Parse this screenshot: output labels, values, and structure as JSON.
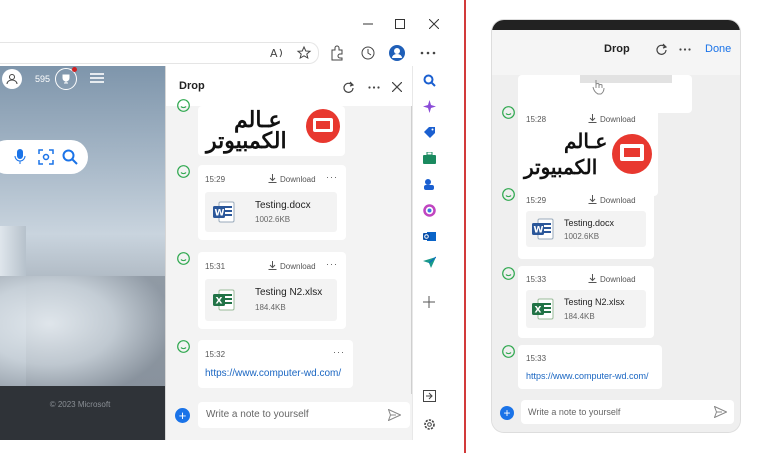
{
  "left": {
    "toolbar_tooltips": [
      "Read aloud",
      "Add favorite",
      "Extensions",
      "History",
      "Profile",
      "Settings and more"
    ],
    "points": "595",
    "footer_text": "© 2023 Microsoft",
    "panel": {
      "title": "Drop",
      "items": [
        {
          "time": "15:29",
          "download_label": "Download",
          "file_name": "Testing.docx",
          "file_size": "1002.6KB",
          "icon": "word-icon"
        },
        {
          "time": "15:31",
          "download_label": "Download",
          "file_name": "Testing N2.xlsx",
          "file_size": "184.4KB",
          "icon": "excel-icon"
        },
        {
          "time": "15:32",
          "link": "https://www.computer-wd.com/"
        }
      ],
      "note_placeholder": "Write a note to yourself",
      "logo_text_top": "عـالم",
      "logo_text_bottom": "الكمبيوتر"
    }
  },
  "right": {
    "panel": {
      "title": "Drop",
      "done_label": "Done",
      "items": [
        {
          "time": "15:28",
          "download_label": "Download"
        },
        {
          "time": "15:29",
          "download_label": "Download",
          "file_name": "Testing.docx",
          "file_size": "1002.6KB",
          "icon": "word-icon"
        },
        {
          "time": "15:33",
          "download_label": "Download",
          "file_name": "Testing N2.xlsx",
          "file_size": "184.4KB",
          "icon": "excel-icon"
        },
        {
          "time": "15:33",
          "link": "https://www.computer-wd.com/"
        }
      ],
      "note_placeholder": "Write a note to yourself",
      "logo_text_top": "عـالم",
      "logo_text_bottom": "الكمبيوتر"
    }
  },
  "colors": {
    "accent": "#1a73e8",
    "logo_red": "#e8382f",
    "divider": "#d23a3a"
  }
}
